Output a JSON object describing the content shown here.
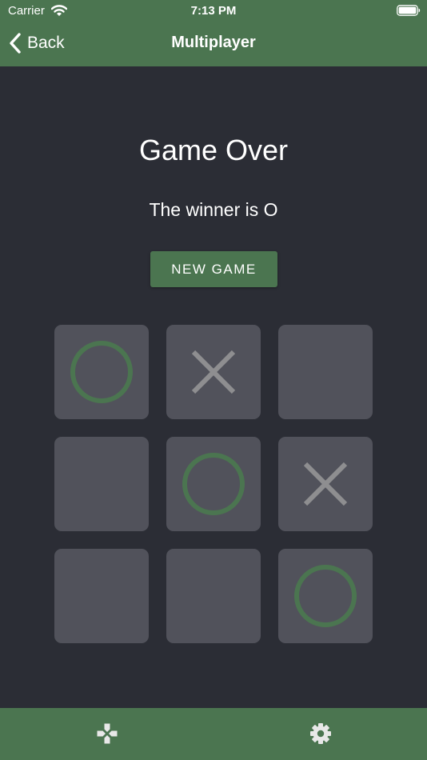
{
  "status_bar": {
    "carrier": "Carrier",
    "time": "7:13 PM"
  },
  "nav": {
    "back_label": "Back",
    "title": "Multiplayer"
  },
  "game": {
    "heading": "Game Over",
    "winner_text": "The winner is O",
    "new_game_label": "NEW GAME",
    "board": [
      "O",
      "X",
      "",
      "",
      "O",
      "X",
      "",
      "",
      "O"
    ]
  },
  "tabs": [
    {
      "name": "game-tab",
      "icon": "gamepad-icon"
    },
    {
      "name": "settings-tab",
      "icon": "gear-icon"
    }
  ],
  "colors": {
    "header": "#4b7550",
    "background": "#2b2d35",
    "cell": "#51525b",
    "o_mark": "#4b7550",
    "x_mark": "#8e8e90",
    "icon_light": "#e8e8e8"
  }
}
